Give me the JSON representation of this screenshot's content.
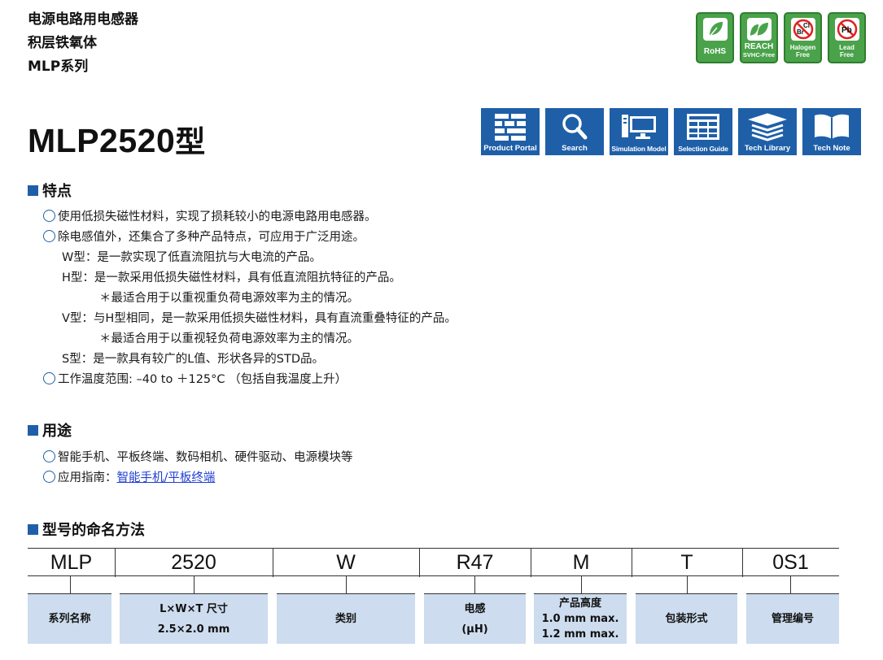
{
  "header": {
    "lines": [
      "电源电路用电感器",
      "积层铁氧体",
      "MLP系列"
    ]
  },
  "certs": [
    {
      "label1": "RoHS",
      "label2": "",
      "icon": "leaf-icon"
    },
    {
      "label1": "REACH",
      "label2": "SVHC-Free",
      "icon": "double-leaf-icon"
    },
    {
      "label1": "Halogen",
      "label2": "Free",
      "icon": "halogen-prohibited-icon",
      "glyph1": "Cl",
      "glyph2": "Br"
    },
    {
      "label1": "Lead",
      "label2": "Free",
      "icon": "lead-prohibited-icon",
      "glyph1": "Pb"
    }
  ],
  "title": {
    "main": "MLP2520",
    "suffix": "型"
  },
  "nav": [
    {
      "label": "Product Portal",
      "icon": "grid-icon"
    },
    {
      "label": "Search",
      "icon": "search-icon"
    },
    {
      "label": "Simulation Model",
      "icon": "monitor-icon"
    },
    {
      "label": "Selection Guide",
      "icon": "table-icon"
    },
    {
      "label": "Tech Library",
      "icon": "stack-icon"
    },
    {
      "label": "Tech Note",
      "icon": "book-icon"
    }
  ],
  "features": {
    "heading": "特点",
    "lines": [
      "使用低损失磁性材料，实现了损耗较小的电源电路用电感器。",
      "除电感值外，还集合了多种产品特点，可应用于广泛用途。",
      "W型：是一款实现了低直流阻抗与大电流的产品。",
      "H型：是一款采用低损失磁性材料，具有低直流阻抗特征的产品。",
      "＊最适合用于以重视重负荷电源效率为主的情况。",
      "V型：与H型相同，是一款采用低损失磁性材料，具有直流重叠特征的产品。",
      "＊最适合用于以重视轻负荷电源效率为主的情况。",
      "S型：是一款具有较广的L值、形状各异的STD品。",
      "工作温度范围: –40 to ＋125°C （包括自我温度上升）"
    ]
  },
  "usage": {
    "heading": "用途",
    "line1": "智能手机、平板终端、数码相机、硬件驱动、电源模块等",
    "line2_prefix": "应用指南：",
    "line2_link": "智能手机/平板终端"
  },
  "naming": {
    "heading": "型号的命名方法",
    "codes": [
      "MLP",
      "2520",
      "W",
      "R47",
      "M",
      "T",
      "0S1"
    ],
    "descriptions": [
      [
        "系列名称"
      ],
      [
        "L×W×T 尺寸",
        "2.5×2.0 mm"
      ],
      [
        "类别"
      ],
      [
        "电感",
        "(μH)"
      ],
      [
        "产品高度",
        "1.0 mm max.",
        "1.2 mm max."
      ],
      [
        "包装形式"
      ],
      [
        "管理编号"
      ]
    ]
  }
}
